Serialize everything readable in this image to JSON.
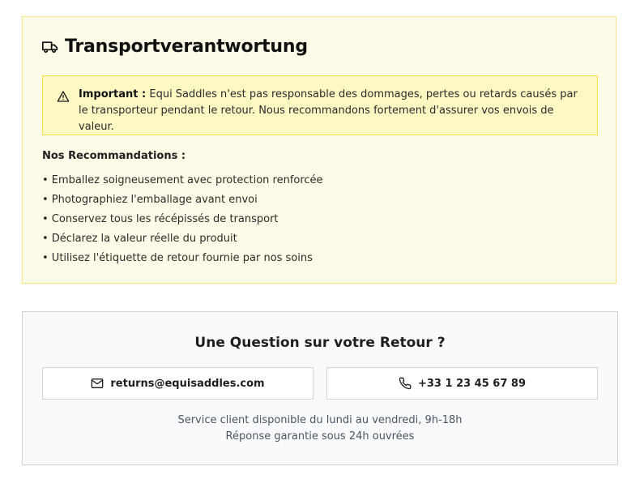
{
  "transport": {
    "icon": "truck-icon",
    "title": "Transportverantwortung",
    "alert": {
      "icon": "warning-triangle-icon",
      "label": "Important :",
      "message": "Equi Saddles n'est pas responsable des dommages, pertes ou retards causés par le transporteur pendant le retour. Nous recommandons fortement d'assurer vos envois de valeur."
    },
    "recommendations_title": "Nos Recommandations :",
    "recommendations": [
      "• Emballez soigneusement avec protection renforcée",
      "• Photographiez l'emballage avant envoi",
      "• Conservez tous les récépissés de transport",
      "• Déclarez la valeur réelle du produit",
      "• Utilisez l'étiquette de retour fournie par nos soins"
    ]
  },
  "question": {
    "title": "Une Question sur votre Retour ?",
    "email": {
      "icon": "mail-icon",
      "label": "returns@equisaddles.com"
    },
    "phone": {
      "icon": "phone-icon",
      "label": "+33 1 23 45 67 89"
    },
    "hours": "Service client disponible du lundi au vendredi, 9h-18h",
    "response": "Réponse garantie sous 24h ouvrées"
  }
}
